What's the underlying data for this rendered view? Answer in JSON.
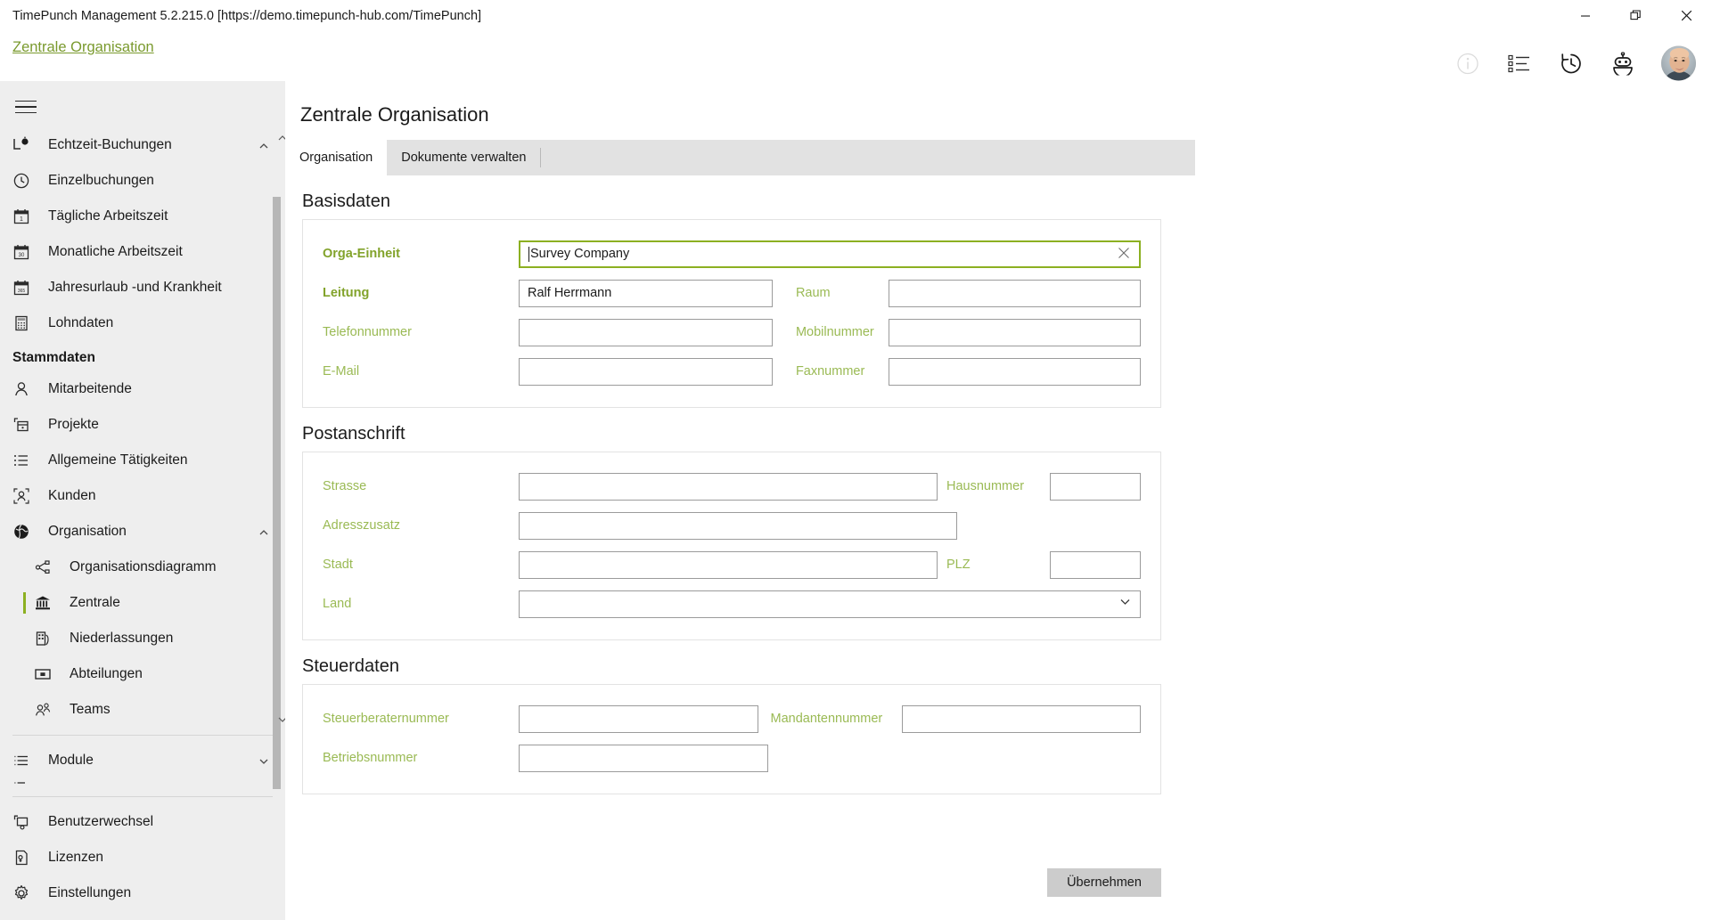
{
  "window": {
    "title": "TimePunch Management 5.2.215.0 [https://demo.timepunch-hub.com/TimePunch]",
    "minimize_label": "Minimieren",
    "restore_label": "Wiederherstellen",
    "close_label": "Schließen"
  },
  "header": {
    "breadcrumb": "Zentrale Organisation",
    "icons": [
      {
        "name": "info-icon",
        "label": "Information"
      },
      {
        "name": "list-icon",
        "label": "Liste"
      },
      {
        "name": "history-icon",
        "label": "Verlauf"
      },
      {
        "name": "robot-icon",
        "label": "Assistent"
      }
    ],
    "avatar_label": "Benutzerprofil"
  },
  "sidebar": {
    "menu_toggle_label": "Menü",
    "items": [
      {
        "label": "Echtzeit-Buchungen",
        "icon": "realtime-booking-icon",
        "level": 0,
        "chevron": "up"
      },
      {
        "label": "Einzelbuchungen",
        "icon": "clock-icon",
        "level": 0
      },
      {
        "label": "Tägliche Arbeitszeit",
        "icon": "calendar-day-icon",
        "level": 0
      },
      {
        "label": "Monatliche Arbeitszeit",
        "icon": "calendar-month-icon",
        "level": 0
      },
      {
        "label": "Jahresurlaub -und Krankheit",
        "icon": "calendar-year-icon",
        "level": 0
      },
      {
        "label": "Lohndaten",
        "icon": "calculator-icon",
        "level": 0
      }
    ],
    "group_title": "Stammdaten",
    "master_items": [
      {
        "label": "Mitarbeitende",
        "icon": "person-icon",
        "level": 0
      },
      {
        "label": "Projekte",
        "icon": "project-icon",
        "level": 0
      },
      {
        "label": "Allgemeine Tätigkeiten",
        "icon": "list-lines-icon",
        "level": 0
      },
      {
        "label": "Kunden",
        "icon": "customer-icon",
        "level": 0
      },
      {
        "label": "Organisation",
        "icon": "globe-icon",
        "level": 0,
        "chevron": "up"
      },
      {
        "label": "Organisationsdiagramm",
        "icon": "org-chart-icon",
        "level": 1
      },
      {
        "label": "Zentrale",
        "icon": "bank-icon",
        "level": 1,
        "selected": true
      },
      {
        "label": "Niederlassungen",
        "icon": "building-icon",
        "level": 1
      },
      {
        "label": "Abteilungen",
        "icon": "department-icon",
        "level": 1
      },
      {
        "label": "Teams",
        "icon": "team-icon",
        "level": 1
      }
    ],
    "modules": [
      {
        "label": "Module",
        "icon": "module-icon",
        "level": 0,
        "chevron": "down"
      }
    ],
    "bottom_items": [
      {
        "label": "Benutzerwechsel",
        "icon": "user-switch-icon"
      },
      {
        "label": "Lizenzen",
        "icon": "license-icon"
      },
      {
        "label": "Einstellungen",
        "icon": "gear-icon"
      }
    ]
  },
  "main": {
    "page_title": "Zentrale Organisation",
    "tabs": [
      {
        "label": "Organisation",
        "active": true
      },
      {
        "label": "Dokumente verwalten",
        "active": false
      }
    ],
    "sections": {
      "basisdaten": {
        "title": "Basisdaten",
        "orga_einheit_label": "Orga-Einheit",
        "orga_einheit_value": "Survey Company",
        "leitung_label": "Leitung",
        "leitung_value": "Ralf Herrmann",
        "raum_label": "Raum",
        "raum_value": "",
        "telefon_label": "Telefonnummer",
        "telefon_value": "",
        "mobil_label": "Mobilnummer",
        "mobil_value": "",
        "email_label": "E-Mail",
        "email_value": "",
        "fax_label": "Faxnummer",
        "fax_value": ""
      },
      "postanschrift": {
        "title": "Postanschrift",
        "strasse_label": "Strasse",
        "strasse_value": "",
        "hausnummer_label": "Hausnummer",
        "hausnummer_value": "",
        "adresszusatz_label": "Adresszusatz",
        "adresszusatz_value": "",
        "stadt_label": "Stadt",
        "stadt_value": "",
        "plz_label": "PLZ",
        "plz_value": "",
        "land_label": "Land",
        "land_value": ""
      },
      "steuerdaten": {
        "title": "Steuerdaten",
        "steuerberaternummer_label": "Steuerberaternummer",
        "steuerberaternummer_value": "",
        "mandantennummer_label": "Mandantennummer",
        "mandantennummer_value": "",
        "betriebsnummer_label": "Betriebsnummer",
        "betriebsnummer_value": ""
      }
    },
    "apply_button": "Übernehmen"
  },
  "colors": {
    "accent_green": "#8cb021",
    "label_green": "#9aba54",
    "required_green": "#82a32b",
    "sidebar_bg": "#eeeeee",
    "tabstrip_bg": "#e2e2e2"
  }
}
